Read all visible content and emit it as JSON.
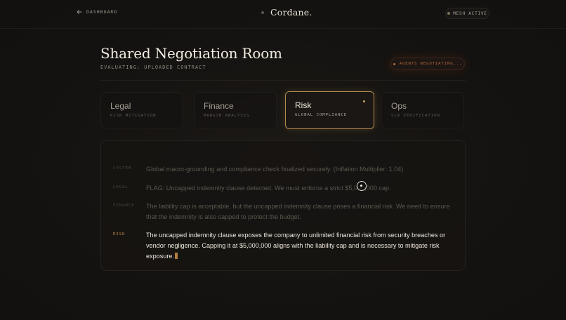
{
  "topbar": {
    "back_label": "DASHBOARD",
    "brand": "Cordane.",
    "mesh_status": "MESH ACTIVE"
  },
  "header": {
    "title": "Shared Negotiation Room",
    "subtitle": "EVALUATING: UPLOADED CONTRACT",
    "agents_status": "AGENTS NEGOTIATING..."
  },
  "agents": [
    {
      "name": "Legal",
      "role": "RISK MITIGATION",
      "active": false
    },
    {
      "name": "Finance",
      "role": "MARGIN ANALYSIS",
      "active": false
    },
    {
      "name": "Risk",
      "role": "GLOBAL COMPLIANCE",
      "active": true
    },
    {
      "name": "Ops",
      "role": "SLA VERIFICATION",
      "active": false
    }
  ],
  "log": [
    {
      "speaker": "SYSTEM",
      "text": "Global macro-grounding and compliance check finalized securely. (Inflation Multiplier: 1.04)"
    },
    {
      "speaker": "LEGAL",
      "text": "FLAG: Uncapped indemnity clause detected. We must enforce a strict $5,000,000 cap."
    },
    {
      "speaker": "FINANCE",
      "text": "The liability cap is acceptable, but the uncapped indemnity clause poses a financial risk. We need to ensure that the indemnity is also capped to protect the budget."
    },
    {
      "speaker": "RISK",
      "text": "The uncapped indemnity clause exposes the company to unlimited financial risk from security breaches or vendor negligence. Capping it at $5,000,000 aligns with the liability cap and is necessary to mitigate risk exposure."
    }
  ],
  "colors": {
    "accent": "#c9a25a",
    "risk_label": "#c38a4a",
    "agents_badge": "#b0673d",
    "background": "#141210"
  }
}
